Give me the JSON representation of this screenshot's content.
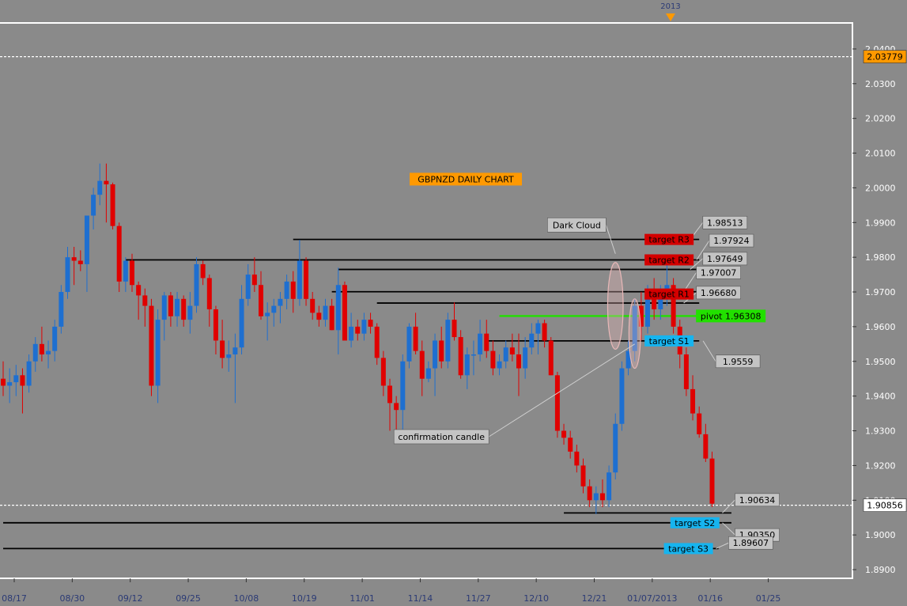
{
  "colors": {
    "background": "#8a8a8a",
    "frame": "#ffffff",
    "bull": "#1e6fd0",
    "bear": "#e00000",
    "level_line": "#000000",
    "pivot": "#22e000",
    "price_label": "#ff9900",
    "resistance_tag": "#d40000",
    "support_tag": "#16b4ef",
    "callout": "#c4c4c4",
    "ellipse": "#e8b8b8"
  },
  "chart_data": {
    "type": "candlestick",
    "title": "GBPNZD DAILY CHART",
    "marker_top": "2013",
    "ylim": [
      1.8875,
      2.0475
    ],
    "y_ticks": [
      "2.0400",
      "2.0300",
      "2.0200",
      "2.0100",
      "2.0000",
      "1.9900",
      "1.9800",
      "1.9700",
      "1.9600",
      "1.9500",
      "1.9400",
      "1.9300",
      "1.9200",
      "1.9100",
      "1.9000",
      "1.8900"
    ],
    "x_ticks": [
      {
        "label": "08/17",
        "i": 0
      },
      {
        "label": "08/30",
        "i": 9
      },
      {
        "label": "09/12",
        "i": 18
      },
      {
        "label": "09/25",
        "i": 27
      },
      {
        "label": "10/08",
        "i": 36
      },
      {
        "label": "10/19",
        "i": 45
      },
      {
        "label": "11/01",
        "i": 54
      },
      {
        "label": "11/14",
        "i": 63
      },
      {
        "label": "11/27",
        "i": 72
      },
      {
        "label": "12/10",
        "i": 81
      },
      {
        "label": "12/21",
        "i": 90
      },
      {
        "label": "01/07/2013",
        "i": 99
      },
      {
        "label": "01/16",
        "i": 108
      },
      {
        "label": "01/25",
        "i": 117
      }
    ],
    "h_lines": [
      {
        "price": 2.03779,
        "label": "2.03779",
        "style": "dashed"
      },
      {
        "price": 1.90856,
        "label": "1.90856",
        "style": "dashed"
      }
    ],
    "candles": [
      [
        1.945,
        1.95,
        1.94,
        1.943
      ],
      [
        1.943,
        1.948,
        1.938,
        1.944
      ],
      [
        1.944,
        1.949,
        1.94,
        1.946
      ],
      [
        1.946,
        1.948,
        1.935,
        1.943
      ],
      [
        1.943,
        1.952,
        1.941,
        1.95
      ],
      [
        1.95,
        1.957,
        1.947,
        1.955
      ],
      [
        1.955,
        1.96,
        1.95,
        1.952
      ],
      [
        1.952,
        1.956,
        1.948,
        1.953
      ],
      [
        1.953,
        1.962,
        1.95,
        1.96
      ],
      [
        1.96,
        1.972,
        1.958,
        1.97
      ],
      [
        1.97,
        1.983,
        1.968,
        1.98
      ],
      [
        1.98,
        1.983,
        1.972,
        1.979
      ],
      [
        1.979,
        1.982,
        1.976,
        1.978
      ],
      [
        1.978,
        1.99,
        1.97,
        1.992
      ],
      [
        1.992,
        2.0,
        1.988,
        1.998
      ],
      [
        1.998,
        2.007,
        1.995,
        2.002
      ],
      [
        2.002,
        2.007,
        1.99,
        2.001
      ],
      [
        2.001,
        2.0015,
        1.988,
        1.989
      ],
      [
        1.989,
        1.99,
        1.97,
        1.973
      ],
      [
        1.973,
        1.98,
        1.97,
        1.979
      ],
      [
        1.979,
        1.981,
        1.97,
        1.972
      ],
      [
        1.972,
        1.973,
        1.962,
        1.969
      ],
      [
        1.969,
        1.971,
        1.96,
        1.966
      ],
      [
        1.966,
        1.968,
        1.94,
        1.943
      ],
      [
        1.943,
        1.965,
        1.938,
        1.962
      ],
      [
        1.962,
        1.97,
        1.956,
        1.969
      ],
      [
        1.969,
        1.97,
        1.96,
        1.963
      ],
      [
        1.963,
        1.97,
        1.96,
        1.968
      ],
      [
        1.968,
        1.969,
        1.96,
        1.962
      ],
      [
        1.962,
        1.97,
        1.958,
        1.966
      ],
      [
        1.966,
        1.98,
        1.964,
        1.978
      ],
      [
        1.978,
        1.979,
        1.972,
        1.974
      ],
      [
        1.974,
        1.975,
        1.96,
        1.965
      ],
      [
        1.965,
        1.966,
        1.952,
        1.956
      ],
      [
        1.956,
        1.962,
        1.948,
        1.951
      ],
      [
        1.951,
        1.956,
        1.947,
        1.952
      ],
      [
        1.952,
        1.958,
        1.938,
        1.954
      ],
      [
        1.954,
        1.972,
        1.952,
        1.968
      ],
      [
        1.968,
        1.978,
        1.966,
        1.975
      ],
      [
        1.975,
        1.98,
        1.97,
        1.972
      ],
      [
        1.972,
        1.976,
        1.962,
        1.963
      ],
      [
        1.963,
        1.967,
        1.956,
        1.964
      ],
      [
        1.964,
        1.968,
        1.96,
        1.966
      ],
      [
        1.966,
        1.97,
        1.961,
        1.968
      ],
      [
        1.968,
        1.975,
        1.965,
        1.973
      ],
      [
        1.973,
        1.976,
        1.964,
        1.968
      ],
      [
        1.968,
        1.985,
        1.966,
        1.979
      ],
      [
        1.979,
        1.98,
        1.966,
        1.968
      ],
      [
        1.968,
        1.97,
        1.962,
        1.964
      ],
      [
        1.964,
        1.966,
        1.96,
        1.962
      ],
      [
        1.962,
        1.968,
        1.96,
        1.966
      ],
      [
        1.966,
        1.968,
        1.959,
        1.959
      ],
      [
        1.959,
        1.977,
        1.952,
        1.972
      ],
      [
        1.972,
        1.973,
        1.958,
        1.956
      ],
      [
        1.956,
        1.964,
        1.954,
        1.96
      ],
      [
        1.96,
        1.962,
        1.956,
        1.958
      ],
      [
        1.958,
        1.964,
        1.956,
        1.962
      ],
      [
        1.962,
        1.964,
        1.958,
        1.96
      ],
      [
        1.96,
        1.961,
        1.949,
        1.951
      ],
      [
        1.951,
        1.953,
        1.94,
        1.943
      ],
      [
        1.943,
        1.945,
        1.93,
        1.938
      ],
      [
        1.938,
        1.94,
        1.928,
        1.936
      ],
      [
        1.936,
        1.952,
        1.93,
        1.95
      ],
      [
        1.95,
        1.961,
        1.948,
        1.96
      ],
      [
        1.96,
        1.964,
        1.952,
        1.953
      ],
      [
        1.953,
        1.956,
        1.94,
        1.945
      ],
      [
        1.945,
        1.95,
        1.944,
        1.948
      ],
      [
        1.948,
        1.958,
        1.94,
        1.956
      ],
      [
        1.956,
        1.96,
        1.948,
        1.95
      ],
      [
        1.95,
        1.964,
        1.948,
        1.962
      ],
      [
        1.962,
        1.967,
        1.956,
        1.957
      ],
      [
        1.957,
        1.959,
        1.945,
        1.946
      ],
      [
        1.946,
        1.954,
        1.942,
        1.952
      ],
      [
        1.952,
        1.956,
        1.946,
        1.952
      ],
      [
        1.952,
        1.962,
        1.95,
        1.958
      ],
      [
        1.958,
        1.962,
        1.951,
        1.953
      ],
      [
        1.953,
        1.956,
        1.946,
        1.948
      ],
      [
        1.948,
        1.952,
        1.946,
        1.95
      ],
      [
        1.95,
        1.956,
        1.948,
        1.954
      ],
      [
        1.954,
        1.958,
        1.95,
        1.952
      ],
      [
        1.952,
        1.958,
        1.94,
        1.948
      ],
      [
        1.948,
        1.957,
        1.945,
        1.954
      ],
      [
        1.954,
        1.961,
        1.952,
        1.958
      ],
      [
        1.958,
        1.962,
        1.952,
        1.961
      ],
      [
        1.961,
        1.962,
        1.954,
        1.956
      ],
      [
        1.956,
        1.957,
        1.946,
        1.946
      ],
      [
        1.946,
        1.947,
        1.928,
        1.93
      ],
      [
        1.93,
        1.932,
        1.926,
        1.928
      ],
      [
        1.928,
        1.93,
        1.922,
        1.924
      ],
      [
        1.924,
        1.926,
        1.918,
        1.92
      ],
      [
        1.92,
        1.922,
        1.912,
        1.914
      ],
      [
        1.914,
        1.916,
        1.908,
        1.91
      ],
      [
        1.91,
        1.914,
        1.906,
        1.912
      ],
      [
        1.912,
        1.916,
        1.908,
        1.91
      ],
      [
        1.91,
        1.92,
        1.908,
        1.918
      ],
      [
        1.918,
        1.935,
        1.916,
        1.932
      ],
      [
        1.932,
        1.95,
        1.93,
        1.948
      ],
      [
        1.948,
        1.956,
        1.946,
        1.953
      ],
      [
        1.953,
        1.968,
        1.95,
        1.966
      ],
      [
        1.966,
        1.97,
        1.956,
        1.96
      ],
      [
        1.96,
        1.972,
        1.958,
        1.97
      ],
      [
        1.97,
        1.974,
        1.962,
        1.965
      ],
      [
        1.965,
        1.972,
        1.962,
        1.969
      ],
      [
        1.969,
        1.978,
        1.966,
        1.972
      ],
      [
        1.972,
        1.974,
        1.958,
        1.96
      ],
      [
        1.96,
        1.962,
        1.948,
        1.952
      ],
      [
        1.952,
        1.954,
        1.94,
        1.942
      ],
      [
        1.942,
        1.946,
        1.933,
        1.935
      ],
      [
        1.935,
        1.937,
        1.928,
        1.929
      ],
      [
        1.929,
        1.932,
        1.921,
        1.922
      ],
      [
        1.922,
        1.924,
        1.908,
        1.909
      ]
    ],
    "level_lines": [
      {
        "price": 1.98513,
        "from": 45,
        "to": 108
      },
      {
        "price": 1.97924,
        "from": 19,
        "to": 108
      },
      {
        "price": 1.97649,
        "from": 52,
        "to": 108
      },
      {
        "price": 1.97007,
        "from": 51,
        "to": 108
      },
      {
        "price": 1.9668,
        "from": 58,
        "to": 108
      },
      {
        "price": 1.9559,
        "from": 75,
        "to": 108
      },
      {
        "price": 1.90634,
        "from": 87,
        "to": 113
      },
      {
        "price": 1.9035,
        "from": 0,
        "to": 113
      },
      {
        "price": 1.89607,
        "from": 0,
        "to": 111
      }
    ],
    "pivot_line": {
      "price": 1.96308,
      "from": 77,
      "to": 108,
      "label": "pivot 1.96308"
    },
    "targets": [
      {
        "label": "target R3",
        "price": 1.98513,
        "kind": "resistance",
        "i": 101
      },
      {
        "label": "target R2",
        "price": 1.97924,
        "kind": "resistance",
        "i": 101
      },
      {
        "label": "target R1",
        "price": 1.9694,
        "kind": "resistance",
        "i": 101
      },
      {
        "label": "target S1",
        "price": 1.9559,
        "kind": "support",
        "i": 101
      },
      {
        "label": "target S2",
        "price": 1.9035,
        "kind": "support",
        "i": 105
      },
      {
        "label": "target S3",
        "price": 1.89607,
        "kind": "support",
        "i": 104
      }
    ],
    "callouts": [
      {
        "label": "1.98513",
        "price": 1.98513,
        "box_price": 1.99,
        "box_i": 112
      },
      {
        "label": "1.97924",
        "price": 1.97924,
        "box_price": 1.9848,
        "box_i": 113
      },
      {
        "label": "1.97649",
        "price": 1.97649,
        "box_price": 1.9796,
        "box_i": 112
      },
      {
        "label": "1.97007",
        "price": 1.97007,
        "box_price": 1.9756,
        "box_i": 111
      },
      {
        "label": "1.96680",
        "price": 1.9668,
        "box_price": 1.9698,
        "box_i": 111
      },
      {
        "label": "1.9559",
        "price": 1.9559,
        "box_price": 1.95,
        "box_i": 114
      },
      {
        "label": "1.90634",
        "price": 1.90634,
        "box_price": 1.9101,
        "box_i": 117
      },
      {
        "label": "1.90350",
        "price": 1.9035,
        "box_price": 1.9,
        "box_i": 117
      },
      {
        "label": "1.89607",
        "price": 1.89607,
        "box_price": 1.8977,
        "box_i": 116
      }
    ],
    "annotations": [
      {
        "label": "Dark Cloud",
        "box_i": 89,
        "box_price": 1.9893,
        "target_i": 95,
        "target_price": 1.981
      },
      {
        "label": "confirmation candle",
        "box_i": 68,
        "box_price": 1.9283,
        "target_i": 98,
        "target_price": 1.955
      }
    ],
    "ellipses": [
      {
        "i": 95,
        "price": 1.966,
        "ri": 1.2,
        "rprice": 0.0125
      },
      {
        "i": 98,
        "price": 1.958,
        "ri": 0.9,
        "rprice": 0.01
      }
    ]
  }
}
